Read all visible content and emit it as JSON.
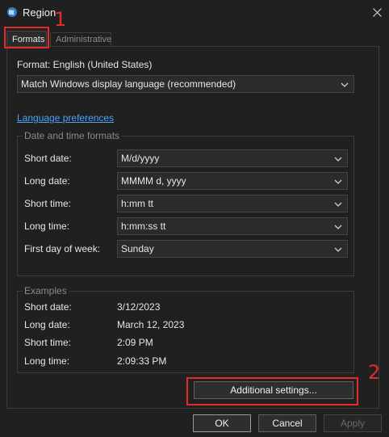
{
  "window": {
    "title": "Region",
    "close_icon": "close-icon",
    "app_icon": "globe-icon"
  },
  "tabs": [
    {
      "label": "Formats",
      "active": true
    },
    {
      "label": "Administrative",
      "active": false
    }
  ],
  "formats": {
    "format_label": "Format: English (United States)",
    "format_value": "Match Windows display language (recommended)",
    "language_link": "Language preferences",
    "date_time_group": "Date and time formats",
    "short_date_label": "Short date:",
    "short_date_value": "M/d/yyyy",
    "long_date_label": "Long date:",
    "long_date_value": "MMMM d, yyyy",
    "short_time_label": "Short time:",
    "short_time_value": "h:mm tt",
    "long_time_label": "Long time:",
    "long_time_value": "h:mm:ss tt",
    "first_day_label": "First day of week:",
    "first_day_value": "Sunday"
  },
  "examples": {
    "group": "Examples",
    "short_date_label": "Short date:",
    "short_date_value": "3/12/2023",
    "long_date_label": "Long date:",
    "long_date_value": "March 12, 2023",
    "short_time_label": "Short time:",
    "short_time_value": "2:09 PM",
    "long_time_label": "Long time:",
    "long_time_value": "2:09:33 PM"
  },
  "buttons": {
    "additional_settings": "Additional settings...",
    "ok": "OK",
    "cancel": "Cancel",
    "apply": "Apply"
  },
  "annotations": {
    "marker_1": "1",
    "marker_2": "2",
    "color": "#e32b2b"
  }
}
